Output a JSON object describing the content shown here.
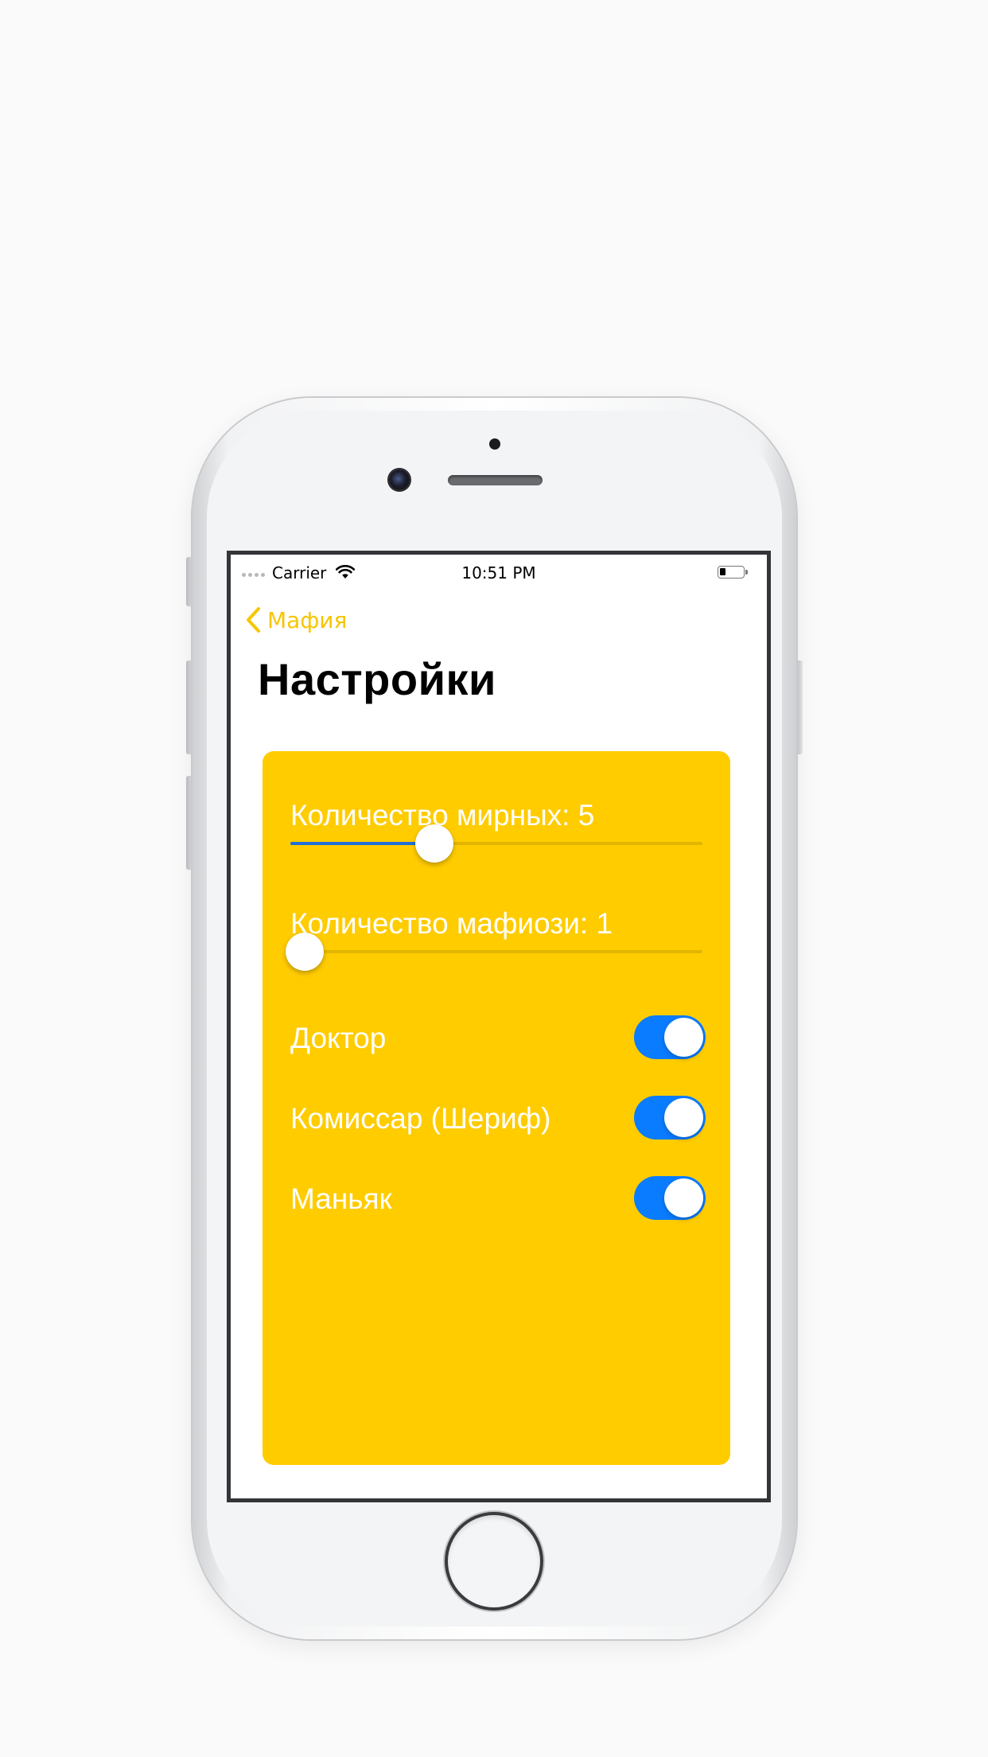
{
  "status_bar": {
    "carrier": "Carrier",
    "time": "10:51 PM",
    "battery_level": 0.2
  },
  "nav": {
    "back_label": "Мафия",
    "title": "Настройки"
  },
  "colors": {
    "accent": "#ffcc00",
    "back_tint": "#f7c600",
    "slider_fill": "#1e6fd9",
    "toggle_on": "#0a7cff"
  },
  "sliders": [
    {
      "label": "Количество мирных: 5",
      "value": 0.35
    },
    {
      "label": "Количество мафиози: 1",
      "value": 0.0
    }
  ],
  "toggles": [
    {
      "label": "Доктор",
      "on": true
    },
    {
      "label": "Комиссар (Шериф)",
      "on": true
    },
    {
      "label": "Маньяк",
      "on": true
    }
  ]
}
